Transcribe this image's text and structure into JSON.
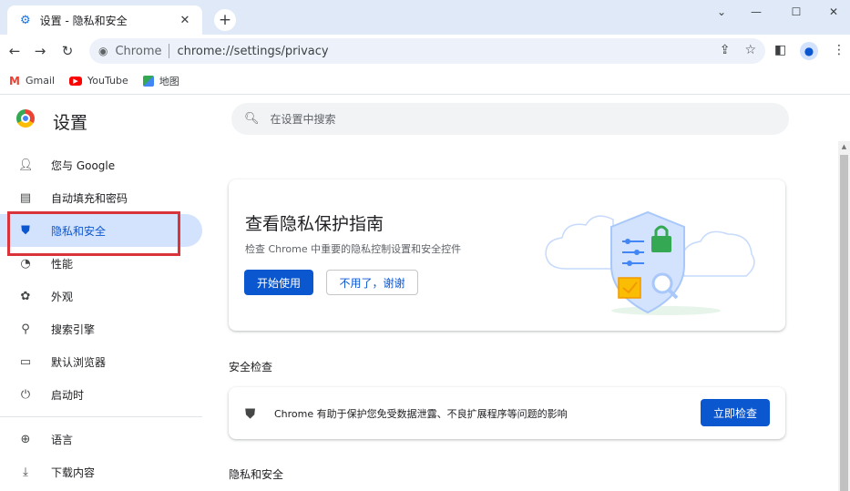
{
  "tab": {
    "title": "设置 - 隐私和安全",
    "close": "✕",
    "new_tab": "+"
  },
  "window_controls": {
    "dropdown": "⌄",
    "minimize": "—",
    "maximize": "☐",
    "close": "✕"
  },
  "toolbar": {
    "back": "←",
    "forward": "→",
    "reload": "↻",
    "site_name": "Chrome",
    "url": "chrome://settings/privacy"
  },
  "bookmarks": [
    {
      "label": "Gmail",
      "icon": "gmail-icon"
    },
    {
      "label": "YouTube",
      "icon": "youtube-icon"
    },
    {
      "label": "地图",
      "icon": "maps-icon"
    }
  ],
  "settings": {
    "title": "设置",
    "search_placeholder": "在设置中搜索"
  },
  "sidebar": {
    "items": [
      {
        "label": "您与 Google",
        "icon": "person-icon"
      },
      {
        "label": "自动填充和密码",
        "icon": "clipboard-icon"
      },
      {
        "label": "隐私和安全",
        "icon": "shield-icon",
        "active": true
      },
      {
        "label": "性能",
        "icon": "speedometer-icon"
      },
      {
        "label": "外观",
        "icon": "palette-icon"
      },
      {
        "label": "搜索引擎",
        "icon": "search-icon"
      },
      {
        "label": "默认浏览器",
        "icon": "browser-icon"
      },
      {
        "label": "启动时",
        "icon": "power-icon"
      }
    ],
    "items_lower": [
      {
        "label": "语言",
        "icon": "globe-icon"
      },
      {
        "label": "下载内容",
        "icon": "download-icon"
      }
    ]
  },
  "promo": {
    "title": "查看隐私保护指南",
    "subtitle": "检查 Chrome 中重要的隐私控制设置和安全控件",
    "start_button": "开始使用",
    "dismiss_button": "不用了，谢谢"
  },
  "safety_check": {
    "section_title": "安全检查",
    "text": "Chrome 有助于保护您免受数据泄露、不良扩展程序等问题的影响",
    "button": "立即检查"
  },
  "privacy_section": {
    "title": "隐私和安全"
  },
  "colors": {
    "accent": "#0b57d0",
    "active_bg": "#d3e3fd",
    "highlight": "#d9343a",
    "tabbar": "#dfe9f7"
  }
}
